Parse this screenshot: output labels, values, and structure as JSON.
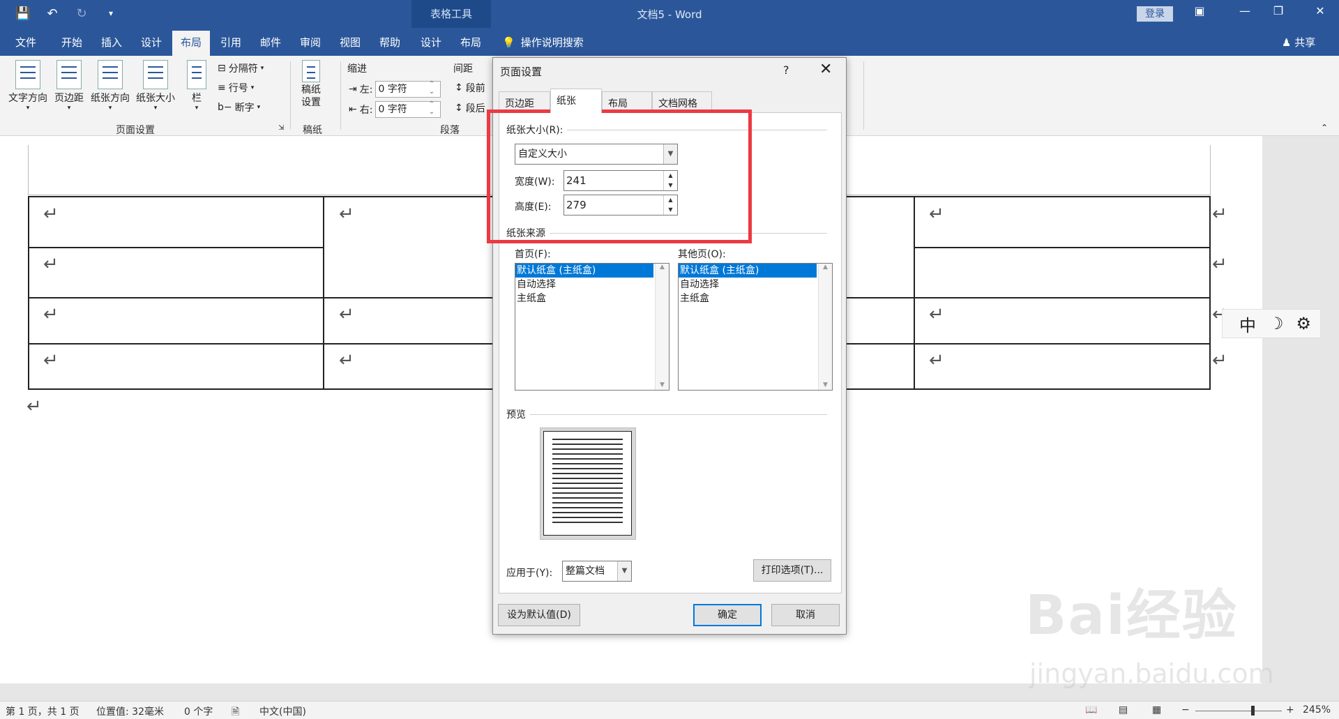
{
  "titlebar": {
    "context_tools": "表格工具",
    "doc_title": "文档5",
    "app_name": "Word",
    "title_sep": " - ",
    "login": "登录",
    "icons": [
      "save-icon",
      "undo-icon",
      "redo-icon",
      "customize-icon"
    ]
  },
  "tabs": [
    "文件",
    "开始",
    "插入",
    "设计",
    "布局",
    "引用",
    "邮件",
    "审阅",
    "视图",
    "帮助",
    "设计",
    "布局"
  ],
  "tell_me": "操作说明搜索",
  "share": "共享",
  "ribbon": {
    "text_direction": "文字方向",
    "margins": "页边距",
    "orientation": "纸张方向",
    "size": "纸张大小",
    "columns": "栏",
    "breaks": "分隔符",
    "line_numbers": "行号",
    "hyphenation": "断字",
    "page_setup_group": "页面设置",
    "draft": "稿纸\n设置",
    "draft_group": "稿纸",
    "indent": "缩进",
    "spacing": "间距",
    "left": "左:",
    "right": "右:",
    "left_value": "0 字符",
    "right_value": "0 字符",
    "before": "段前",
    "after": "段后",
    "paragraph_group": "段落"
  },
  "dialog": {
    "title": "页面设置",
    "help": "?",
    "tabs": [
      "页边距",
      "纸张",
      "布局",
      "文档网格"
    ],
    "active_tab": 1,
    "paper_size_label": "纸张大小(R):",
    "paper_size_value": "自定义大小",
    "width_label": "宽度(W):",
    "width_value": "241",
    "height_label": "高度(E):",
    "height_value": "279",
    "paper_source_label": "纸张来源",
    "first_page_label": "首页(F):",
    "other_pages_label": "其他页(O):",
    "tray_items": [
      "默认纸盒 (主纸盒)",
      "自动选择",
      "主纸盒"
    ],
    "preview_label": "预览",
    "apply_to_label": "应用于(Y):",
    "apply_to_value": "整篇文档",
    "print_options": "打印选项(T)...",
    "set_default": "设为默认值(D)",
    "ok": "确定",
    "cancel": "取消"
  },
  "ime": {
    "lang": "中"
  },
  "status": {
    "page": "第 1 页，共 1 页",
    "position": "位置值: 32毫米",
    "words": "0 个字",
    "language": "中文(中国)",
    "zoom": "245%"
  },
  "watermark": {
    "main": "Bai经验",
    "url": "jingyan.baidu.com"
  }
}
